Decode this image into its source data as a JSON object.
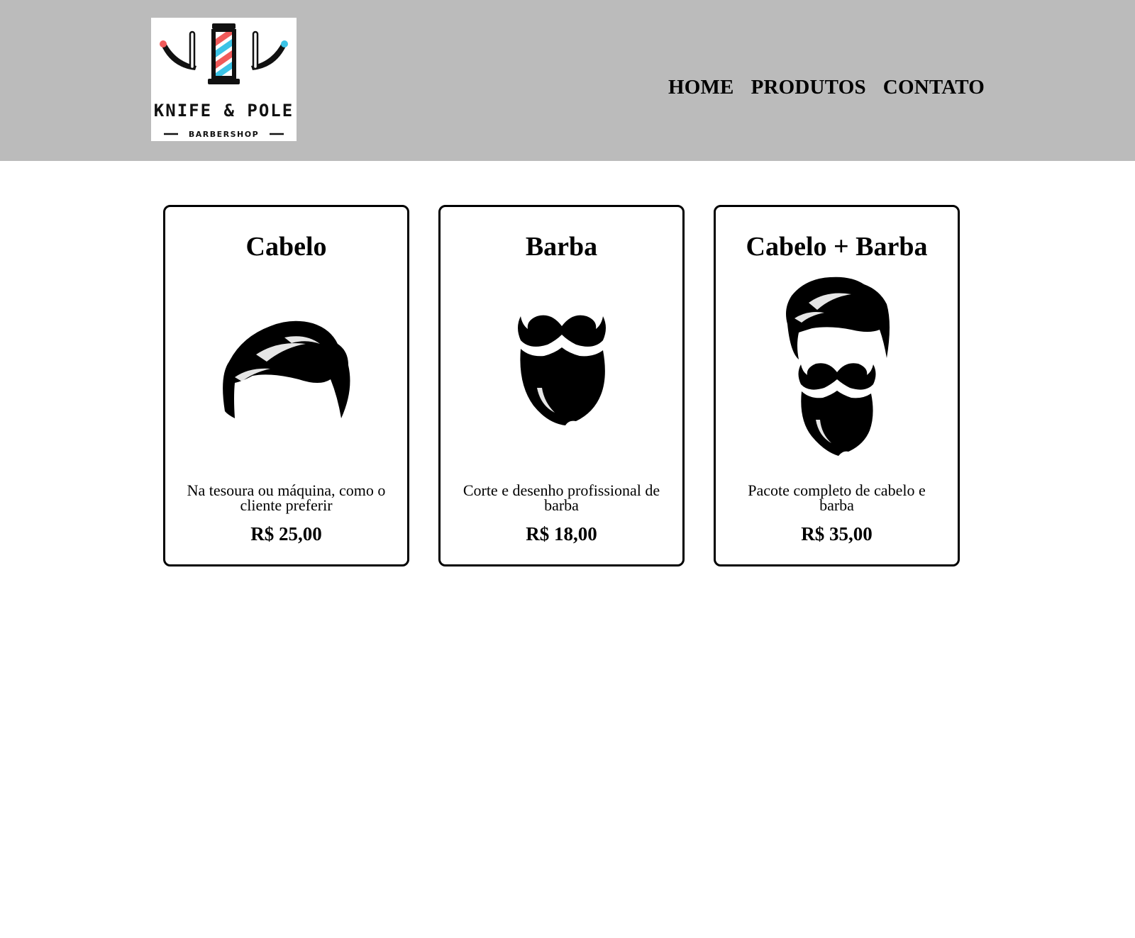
{
  "header": {
    "logo": {
      "brand": "KNIFE & POLE",
      "tagline": "BARBERSHOP"
    },
    "nav": [
      {
        "label": "HOME"
      },
      {
        "label": "PRODUTOS"
      },
      {
        "label": "CONTATO"
      }
    ]
  },
  "products": [
    {
      "title": "Cabelo",
      "description": "Na tesoura ou máquina, como o cliente preferir",
      "price": "R$ 25,00",
      "icon": "hair-icon"
    },
    {
      "title": "Barba",
      "description": "Corte e desenho profissional de barba",
      "price": "R$ 18,00",
      "icon": "beard-icon"
    },
    {
      "title": "Cabelo + Barba",
      "description": "Pacote completo de cabelo e barba",
      "price": "R$ 35,00",
      "icon": "hair-and-beard-icon"
    }
  ],
  "colors": {
    "header_bg": "#bbbbbb",
    "pole_red": "#f05a5a",
    "pole_blue": "#3cc3e6",
    "text": "#000000"
  }
}
